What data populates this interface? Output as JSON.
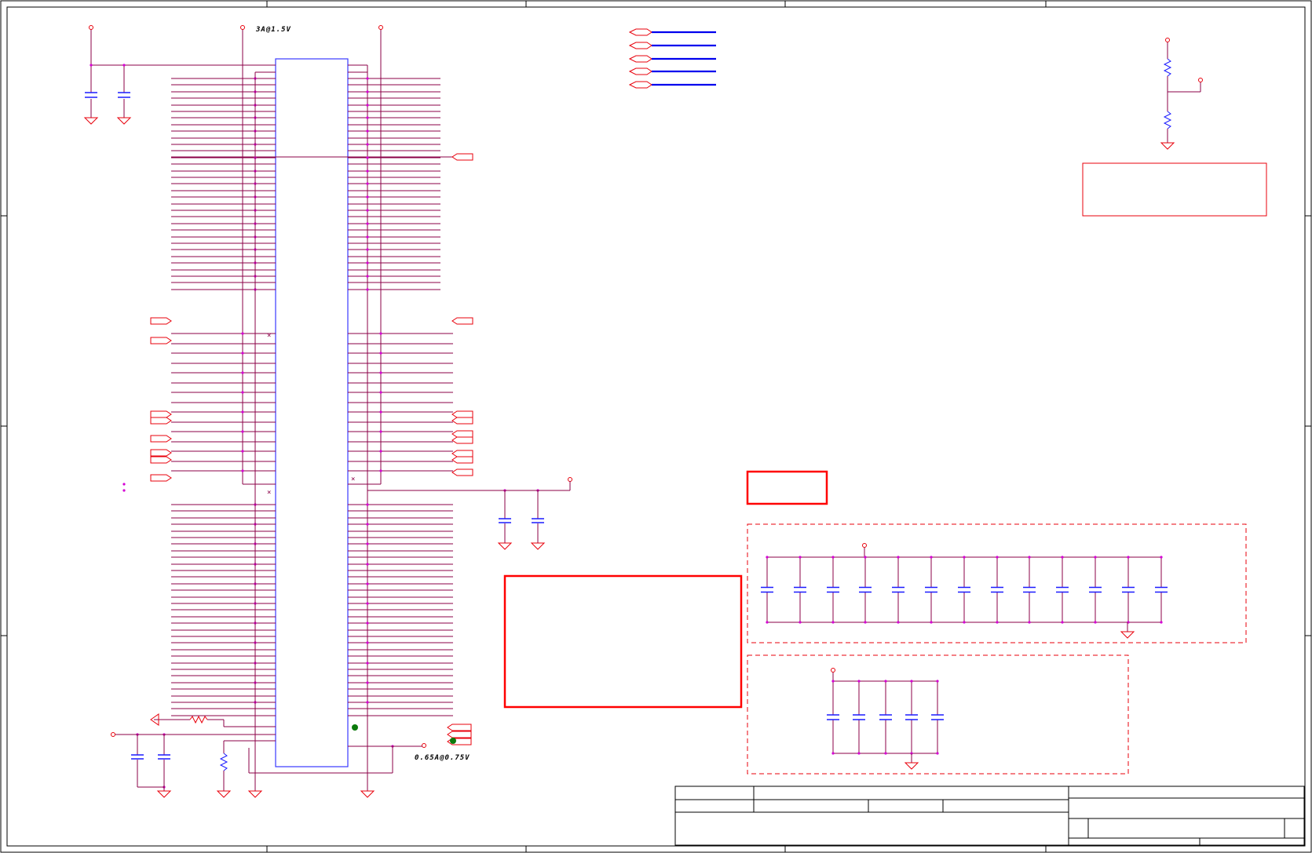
{
  "colors": {
    "wire": "#8b0047",
    "component": "#e8000b",
    "cap_plate": "#1a1aff",
    "bus": "#0000ee",
    "junction": "#d400d4",
    "ic_body": "#3a3aff",
    "frame": "#000000",
    "probe": "#0b7a0b",
    "note_box": "#ff0000"
  },
  "annotations": {
    "vdd_label": "3A@1.5V",
    "core_label": "0.65A@0.75V"
  },
  "icons": {
    "ground": "ground-symbol-icon",
    "capacitor": "capacitor-icon",
    "resistor": "resistor-icon",
    "port": "offpage-port-icon",
    "test_point": "test-point-icon"
  }
}
